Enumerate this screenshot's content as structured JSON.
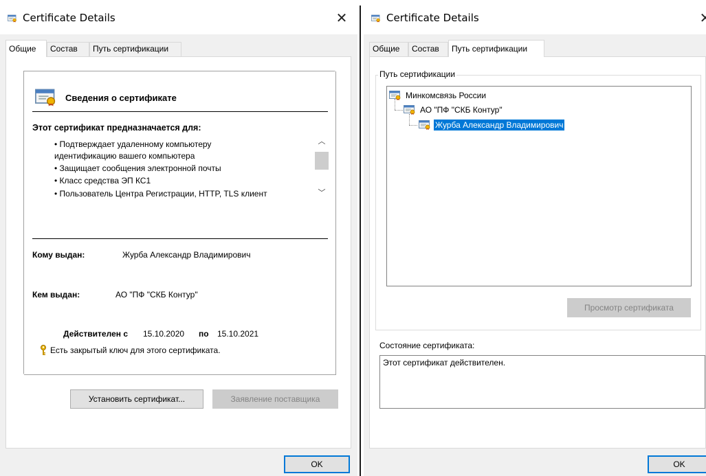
{
  "window_title": "Certificate Details",
  "colors": {
    "accent": "#0078d7",
    "panel": "#f0f0f0",
    "selection": "#0078d7"
  },
  "icons": {
    "title": "certificate-icon",
    "close": "close-icon",
    "key": "key-icon",
    "tree_node": "certificate-icon"
  },
  "left": {
    "tabs": [
      "Общие",
      "Состав",
      "Путь сертификации"
    ],
    "active_tab": 0,
    "heading": "Сведения о сертификате",
    "purpose_title": "Этот сертификат предназначается для:",
    "purposes": [
      "• Подтверждает удаленному компьютеру",
      "идентификацию вашего компьютера",
      "• Защищает сообщения электронной почты",
      "• Класс средства ЭП КС1",
      "• Пользователь Центра Регистрации, HTTP, TLS клиент"
    ],
    "issued_to_label": "Кому выдан:",
    "issued_to_value": "Журба Александр Владимирович",
    "issued_by_label": "Кем выдан:",
    "issued_by_value": "АО \"ПФ \"СКБ Контур\"",
    "valid_from_label": "Действителен с",
    "valid_from": "15.10.2020",
    "valid_to_label": "по",
    "valid_to": "15.10.2021",
    "private_key_note": "Есть закрытый ключ для этого сертификата.",
    "install_button": "Установить сертификат...",
    "issuer_statement_button": "Заявление поставщика",
    "ok_button": "OK"
  },
  "right": {
    "tabs": [
      "Общие",
      "Состав",
      "Путь сертификации"
    ],
    "active_tab": 2,
    "path_group_label": "Путь сертификации",
    "tree": [
      {
        "label": "Минкомсвязь России",
        "level": 0,
        "selected": false
      },
      {
        "label": "АО \"ПФ \"СКБ Контур\"",
        "level": 1,
        "selected": false
      },
      {
        "label": "Журба Александр Владимирович",
        "level": 2,
        "selected": true
      }
    ],
    "view_cert_button": "Просмотр сертификата",
    "status_label": "Состояние сертификата:",
    "status_text": "Этот сертификат действителен.",
    "ok_button": "OK"
  }
}
